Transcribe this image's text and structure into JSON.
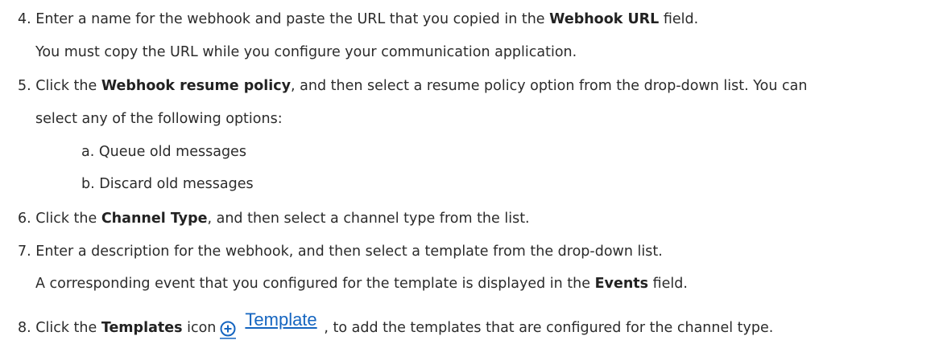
{
  "steps": [
    {
      "number": "4.",
      "pre": "Enter a name for the webhook and paste the URL that you copied in the ",
      "bold": "Webhook URL",
      "post": " field.",
      "note": "You must copy the URL while you configure your communication application."
    },
    {
      "number": "5.",
      "pre": "Click the ",
      "bold": "Webhook resume policy",
      "post": ", and then select a resume policy option from the drop-down list. You can",
      "cont": "select any of the following options:",
      "options": [
        {
          "letter": "a.",
          "text": "Queue old messages"
        },
        {
          "letter": "b.",
          "text": "Discard old messages"
        }
      ]
    },
    {
      "number": "6.",
      "pre": "Click the ",
      "bold": "Channel Type",
      "post": ", and then select a channel type from the list."
    },
    {
      "number": "7.",
      "text": "Enter a description for the webhook, and then select a template from the drop-down list.",
      "note_pre": "A corresponding event that you configured for the template is displayed in the ",
      "note_bold": "Events",
      "note_post": " field."
    },
    {
      "number": "8.",
      "pre": "Click the ",
      "bold": "Templates",
      "mid": "  icon",
      "link": "Template",
      "post": ", to add the templates that are configured for the channel type.",
      "icon": "add-circle-icon",
      "accent": "#1565c0"
    }
  ]
}
